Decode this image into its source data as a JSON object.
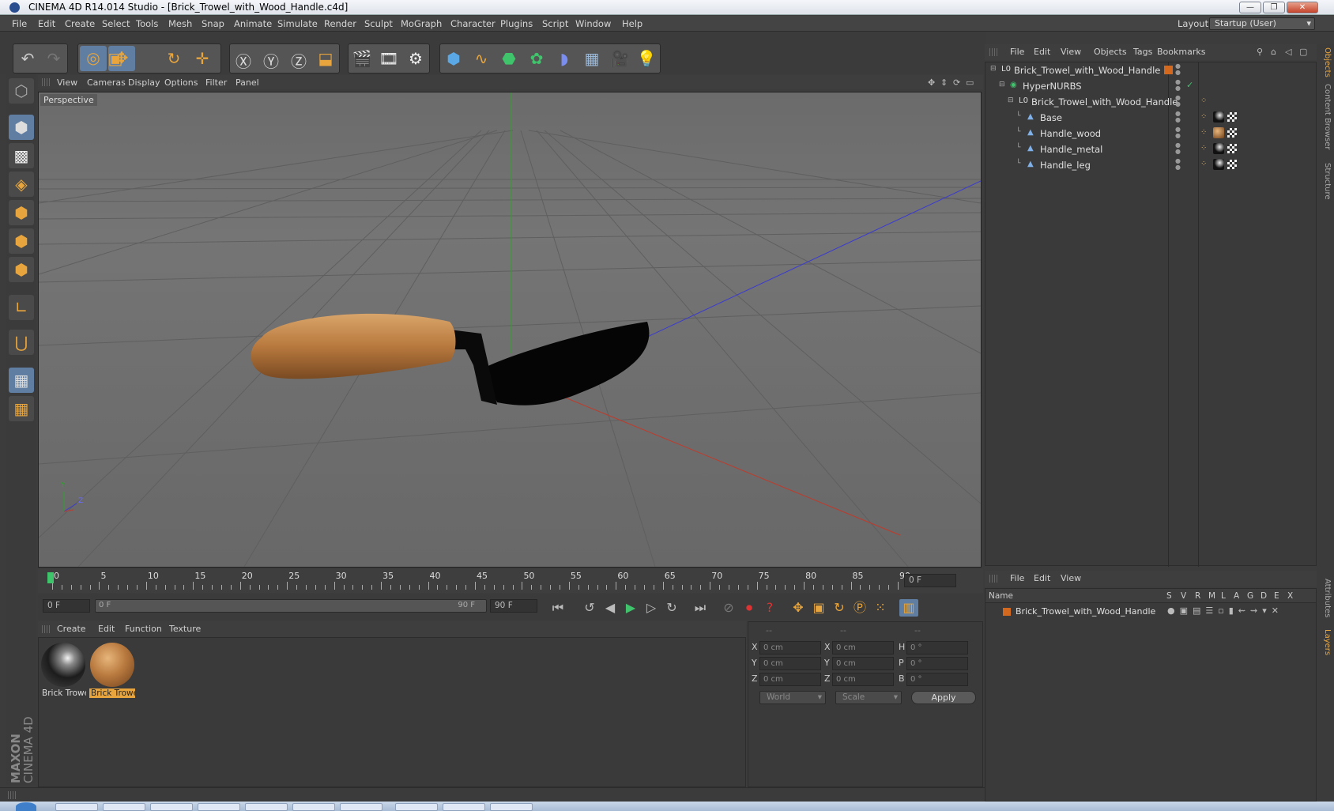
{
  "window": {
    "title": "CINEMA 4D R14.014 Studio - [Brick_Trowel_with_Wood_Handle.c4d]"
  },
  "menubar": {
    "items": [
      "File",
      "Edit",
      "Create",
      "Select",
      "Tools",
      "Mesh",
      "Snap",
      "Animate",
      "Simulate",
      "Render",
      "Sculpt",
      "MoGraph",
      "Character",
      "Plugins",
      "Script",
      "Window",
      "Help"
    ],
    "layout_label": "Layout:",
    "layout_value": "Startup (User)"
  },
  "viewport": {
    "menu": [
      "View",
      "Cameras",
      "Display",
      "Options",
      "Filter",
      "Panel"
    ],
    "label": "Perspective",
    "axis_labels": {
      "y": "Y",
      "z": "Z",
      "x": "X"
    }
  },
  "timeline": {
    "ticks": [
      "0",
      "5",
      "10",
      "15",
      "20",
      "25",
      "30",
      "35",
      "40",
      "45",
      "50",
      "55",
      "60",
      "65",
      "70",
      "75",
      "80",
      "85",
      "90"
    ],
    "current_frame": "0 F",
    "start_field": "0 F",
    "range_start": "0 F",
    "range_end": "90 F",
    "end_field": "90 F"
  },
  "materials": {
    "menu": [
      "Create",
      "Edit",
      "Function",
      "Texture"
    ],
    "items": [
      {
        "label": "Brick Trowel",
        "kind": "metal",
        "selected": false
      },
      {
        "label": "Brick Trowel",
        "kind": "wood",
        "selected": true
      }
    ]
  },
  "coords": {
    "headers": [
      "--",
      "--",
      "--"
    ],
    "rows": [
      {
        "l1": "X",
        "v1": "0 cm",
        "l2": "X",
        "v2": "0 cm",
        "l3": "H",
        "v3": "0 °"
      },
      {
        "l1": "Y",
        "v1": "0 cm",
        "l2": "Y",
        "v2": "0 cm",
        "l3": "P",
        "v3": "0 °"
      },
      {
        "l1": "Z",
        "v1": "0 cm",
        "l2": "Z",
        "v2": "0 cm",
        "l3": "B",
        "v3": "0 °"
      }
    ],
    "space": "World",
    "mode": "Scale",
    "apply": "Apply"
  },
  "object_manager": {
    "menu": [
      "File",
      "Edit",
      "View",
      "Objects",
      "Tags",
      "Bookmarks"
    ],
    "tree": [
      {
        "name": "Brick_Trowel_with_Wood_Handle",
        "depth": 0,
        "type": "null"
      },
      {
        "name": "HyperNURBS",
        "depth": 1,
        "type": "nurbs"
      },
      {
        "name": "Brick_Trowel_with_Wood_Handle",
        "depth": 2,
        "type": "null"
      },
      {
        "name": "Base",
        "depth": 3,
        "type": "poly",
        "material": "metal"
      },
      {
        "name": "Handle_wood",
        "depth": 3,
        "type": "poly",
        "material": "wood"
      },
      {
        "name": "Handle_metal",
        "depth": 3,
        "type": "poly",
        "material": "metal"
      },
      {
        "name": "Handle_leg",
        "depth": 3,
        "type": "poly",
        "material": "metal"
      }
    ]
  },
  "layer_manager": {
    "menu": [
      "File",
      "Edit",
      "View"
    ],
    "columns": [
      "Name",
      "S",
      "V",
      "R",
      "M",
      "L",
      "A",
      "G",
      "D",
      "E",
      "X"
    ],
    "layers": [
      {
        "name": "Brick_Trowel_with_Wood_Handle",
        "color": "#d2691e"
      }
    ]
  },
  "right_tabs": [
    "Objects",
    "Content Browser",
    "Structure",
    "Attributes",
    "Layers"
  ],
  "brand": {
    "line1": "MAXON",
    "line2": "CINEMA 4D"
  },
  "colors": {
    "accent": "#e8a53d",
    "selected_tool": "#5f7ea1",
    "x_axis": "#c03a2b",
    "y_axis": "#2fa32f",
    "z_axis": "#3a3ad0"
  }
}
